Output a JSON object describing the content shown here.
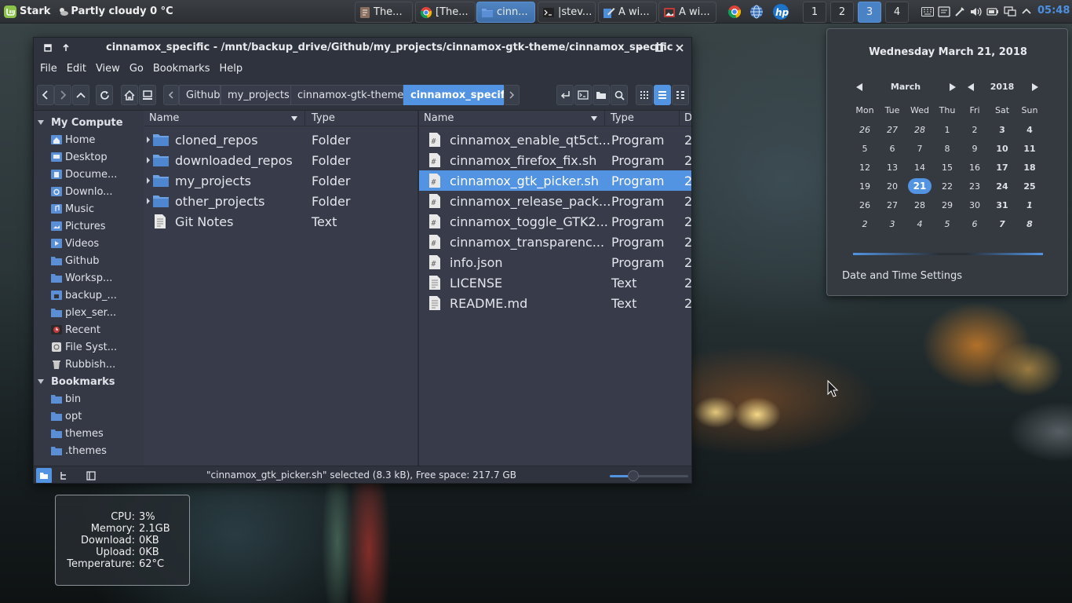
{
  "taskbar": {
    "menu_label": "Stark",
    "weather": "Partly cloudy 0 °C",
    "windows": [
      {
        "label": "The...",
        "icon": "document-icon"
      },
      {
        "label": "[The...",
        "icon": "chrome-icon"
      },
      {
        "label": "cinn...",
        "icon": "folder-icon",
        "active": true
      },
      {
        "label": "|stev...",
        "icon": "terminal-icon"
      },
      {
        "label": "A wi...",
        "icon": "editor-icon"
      },
      {
        "label": "A wi...",
        "icon": "image-viewer-icon"
      }
    ],
    "workspaces": [
      "1",
      "2",
      "3",
      "4"
    ],
    "active_workspace": "3",
    "clock": "05:48"
  },
  "filemanager": {
    "title": "cinnamox_specific - /mnt/backup_drive/Github/my_projects/cinnamox-gtk-theme/cinnamox_specific",
    "menu": [
      "File",
      "Edit",
      "View",
      "Go",
      "Bookmarks",
      "Help"
    ],
    "breadcrumbs": [
      "Github",
      "my_projects",
      "cinnamox-gtk-theme",
      "cinnamox_specific"
    ],
    "sidebar": {
      "computer_header": "My Compute",
      "computer_items": [
        {
          "label": "Home",
          "icon": "home-icon"
        },
        {
          "label": "Desktop",
          "icon": "desktop-icon"
        },
        {
          "label": "Docume...",
          "icon": "documents-icon"
        },
        {
          "label": "Downlo...",
          "icon": "downloads-icon"
        },
        {
          "label": "Music",
          "icon": "music-icon"
        },
        {
          "label": "Pictures",
          "icon": "pictures-icon"
        },
        {
          "label": "Videos",
          "icon": "videos-icon"
        },
        {
          "label": "Github",
          "icon": "folder-icon"
        },
        {
          "label": "Worksp...",
          "icon": "folder-icon"
        },
        {
          "label": "backup_...",
          "icon": "drive-icon"
        },
        {
          "label": "plex_ser...",
          "icon": "folder-icon"
        },
        {
          "label": "Recent",
          "icon": "recent-icon"
        },
        {
          "label": "File Syst...",
          "icon": "filesystem-icon"
        },
        {
          "label": "Rubbish...",
          "icon": "trash-icon"
        }
      ],
      "bookmarks_header": "Bookmarks",
      "bookmark_items": [
        {
          "label": "bin",
          "icon": "folder-icon"
        },
        {
          "label": "opt",
          "icon": "folder-icon"
        },
        {
          "label": "themes",
          "icon": "folder-icon"
        },
        {
          "label": ".themes",
          "icon": "folder-icon"
        }
      ]
    },
    "left_pane": {
      "columns": [
        "Name",
        "Type"
      ],
      "rows": [
        {
          "name": "cloned_repos",
          "type": "Folder",
          "kind": "folder"
        },
        {
          "name": "downloaded_repos",
          "type": "Folder",
          "kind": "folder"
        },
        {
          "name": "my_projects",
          "type": "Folder",
          "kind": "folder"
        },
        {
          "name": "other_projects",
          "type": "Folder",
          "kind": "folder"
        },
        {
          "name": "Git Notes",
          "type": "Text",
          "kind": "text"
        }
      ]
    },
    "right_pane": {
      "columns": [
        "Name",
        "Type",
        "D"
      ],
      "rows": [
        {
          "name": "cinnamox_enable_qt5ct...",
          "type": "Program",
          "date": "2",
          "kind": "script"
        },
        {
          "name": "cinnamox_firefox_fix.sh",
          "type": "Program",
          "date": "2",
          "kind": "script"
        },
        {
          "name": "cinnamox_gtk_picker.sh",
          "type": "Program",
          "date": "2",
          "kind": "script",
          "selected": true
        },
        {
          "name": "cinnamox_release_pack...",
          "type": "Program",
          "date": "2",
          "kind": "script"
        },
        {
          "name": "cinnamox_toggle_GTK2...",
          "type": "Program",
          "date": "2",
          "kind": "script"
        },
        {
          "name": "cinnamox_transparenc...",
          "type": "Program",
          "date": "2",
          "kind": "script"
        },
        {
          "name": "info.json",
          "type": "Program",
          "date": "2",
          "kind": "script"
        },
        {
          "name": "LICENSE",
          "type": "Text",
          "date": "2",
          "kind": "text"
        },
        {
          "name": "README.md",
          "type": "Text",
          "date": "2",
          "kind": "text"
        }
      ]
    },
    "status": "\"cinnamox_gtk_picker.sh\" selected (8.3 kB), Free space: 217.7 GB",
    "zoom_level": 0.3
  },
  "calendar": {
    "date_header": "Wednesday March 21, 2018",
    "month": "March",
    "year": "2018",
    "weekdays": [
      "Mon",
      "Tue",
      "Wed",
      "Thu",
      "Fri",
      "Sat",
      "Sun"
    ],
    "weeks": [
      [
        "26",
        "27",
        "28",
        "1",
        "2",
        "3",
        "4"
      ],
      [
        "5",
        "6",
        "7",
        "8",
        "9",
        "10",
        "11"
      ],
      [
        "12",
        "13",
        "14",
        "15",
        "16",
        "17",
        "18"
      ],
      [
        "19",
        "20",
        "21",
        "22",
        "23",
        "24",
        "25"
      ],
      [
        "26",
        "27",
        "28",
        "29",
        "30",
        "31",
        "1"
      ],
      [
        "2",
        "3",
        "4",
        "5",
        "6",
        "7",
        "8"
      ]
    ],
    "today": "21",
    "settings_label": "Date and Time Settings"
  },
  "sysmon": {
    "rows": [
      {
        "label": "CPU:",
        "value": "3%"
      },
      {
        "label": "Memory:",
        "value": "2.1GB"
      },
      {
        "label": "Download:",
        "value": "0KB"
      },
      {
        "label": "Upload:",
        "value": "0KB"
      },
      {
        "label": "Temperature:",
        "value": "62°C"
      }
    ]
  },
  "colors": {
    "accent": "#5294e2",
    "clock": "#4d8fe0",
    "window_bg": "#383c4a",
    "panel_bg": "#2f333d"
  }
}
